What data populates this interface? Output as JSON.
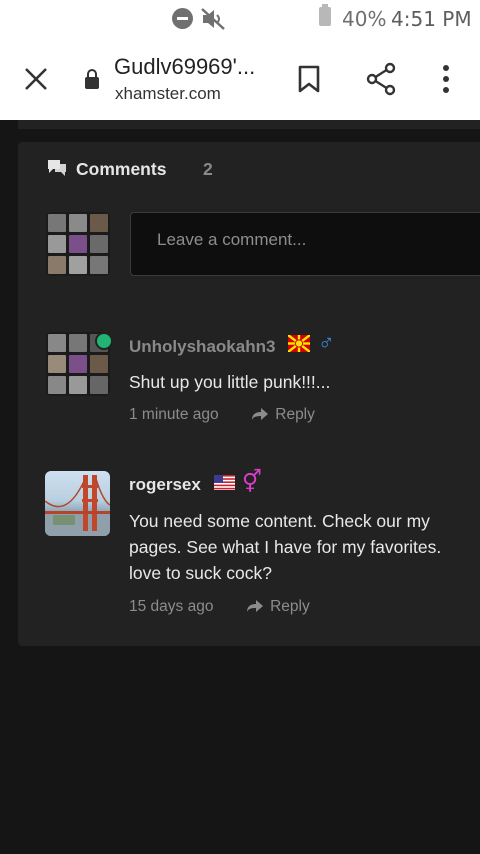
{
  "status_bar": {
    "battery": "40%",
    "time": "4:51 PM"
  },
  "browser": {
    "page_title": "Gudlv69969'...",
    "domain": "xhamster.com"
  },
  "comments": {
    "title": "Comments",
    "count": "2",
    "input_placeholder": "Leave a comment...",
    "items": [
      {
        "username": "Unholyshaokahn3",
        "username_color": "#8a8a8a",
        "text": "Shut up you little punk!!!...",
        "time": "1 minute ago",
        "reply_label": "Reply",
        "flag": "north-macedonia-flag",
        "gender": "♂",
        "gender_color": "#3c8fe0",
        "online": true
      },
      {
        "username": "rogersex",
        "username_color": "#e6e6e6",
        "text": "You need some content.  Check our my pages.  See what I have for my favorites.  love to suck cock?",
        "time": "15 days ago",
        "reply_label": "Reply",
        "flag": "usa-flag",
        "gender": "⚥",
        "gender_color": "#d93ecb"
      }
    ]
  },
  "colors": {
    "page_bg": "#151515",
    "card_bg": "#222222",
    "online": "#21b573"
  }
}
